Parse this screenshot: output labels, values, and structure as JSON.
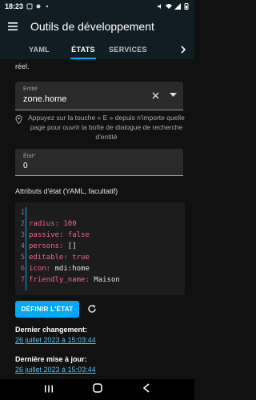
{
  "status_bar": {
    "time": "18:23"
  },
  "app_bar": {
    "title": "Outils de développement"
  },
  "tabs": [
    {
      "label": "YAML"
    },
    {
      "label": "ÉTATS",
      "active": true
    },
    {
      "label": "SERVICES"
    }
  ],
  "content": {
    "partial_text": "réel.",
    "entity_field": {
      "label": "Entité",
      "value": "zone.home"
    },
    "hint": "Appuyez sur la touche « E » depuis n'importe quelle page pour ouvrir la boîte de dialogue de recherche d'entité",
    "state_field": {
      "label": "État*",
      "value": "0"
    },
    "attributes_label": "Attributs d'état (YAML, facultatif)",
    "code_lines": [
      {
        "n": "1",
        "key": "",
        "value": ""
      },
      {
        "n": "2",
        "key": "radius:",
        "value": "100"
      },
      {
        "n": "3",
        "key": "passive:",
        "value": "false"
      },
      {
        "n": "4",
        "key": "persons:",
        "value": "[]"
      },
      {
        "n": "5",
        "key": "editable:",
        "value": "true"
      },
      {
        "n": "6",
        "key": "icon:",
        "value": "mdi:home"
      },
      {
        "n": "7",
        "key": "friendly_name:",
        "value": "Maison"
      }
    ],
    "set_state_label": "DÉFINIR L'ÉTAT",
    "last_changed_label": "Dernier changement:",
    "last_changed_value": "26 juillet 2023 à 15:03:44",
    "last_updated_label": "Dernière mise à jour:",
    "last_updated_value": "26 juillet 2023 à 15:03:44"
  },
  "colors": {
    "accent": "#03a9f4",
    "app_bar": "#101e24",
    "background": "#111111",
    "yaml_key": "#f06292",
    "link": "#4fc3f7"
  },
  "icons": [
    "menu-icon",
    "chevron-right-icon",
    "close-icon",
    "dropdown-icon",
    "info-icon",
    "refresh-icon",
    "recent-apps-icon",
    "home-icon",
    "back-icon"
  ]
}
